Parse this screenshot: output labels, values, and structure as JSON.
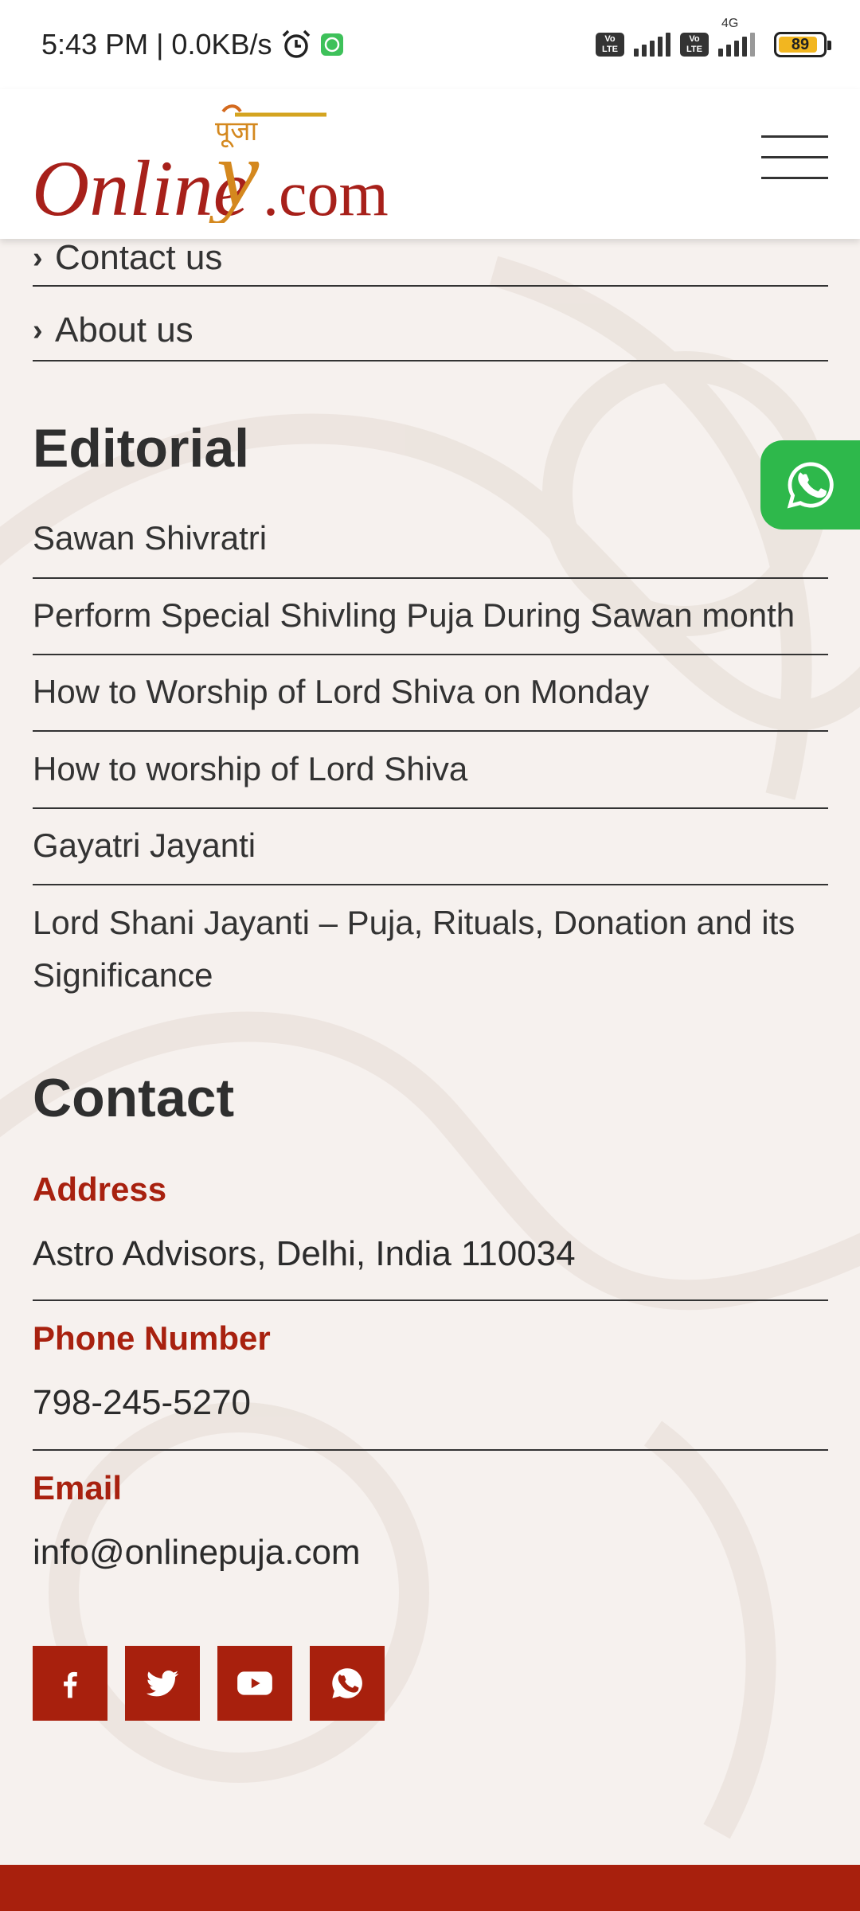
{
  "status_bar": {
    "time_network": "5:43 PM | 0.0KB/s",
    "battery": "89",
    "lte1": "Vo LTE",
    "lte2": "Vo LTE",
    "net": "4G"
  },
  "header": {
    "logo_text_online": "Online",
    "logo_text_com": ".com",
    "logo_hindi": "पूजा"
  },
  "links": [
    {
      "label": "Contact us"
    },
    {
      "label": "About us"
    }
  ],
  "editorial": {
    "title": "Editorial",
    "items": [
      "Sawan Shivratri",
      "Perform Special Shivling Puja During Sawan month",
      "How to Worship of Lord Shiva on Monday",
      "How to worship of Lord Shiva",
      "Gayatri Jayanti",
      "Lord Shani Jayanti – Puja, Rituals, Donation and its Significance"
    ]
  },
  "contact": {
    "title": "Contact",
    "address_label": "Address",
    "address_value": "Astro Advisors, Delhi, India 110034",
    "phone_label": "Phone Number",
    "phone_value": "798-245-5270",
    "email_label": "Email",
    "email_value": "info@onlinepuja.com"
  },
  "social": [
    "facebook-icon",
    "twitter-icon",
    "youtube-icon",
    "whatsapp-icon"
  ],
  "colors": {
    "accent": "#a8200d",
    "whatsapp": "#2eb84b",
    "background": "#f6f1ee"
  }
}
